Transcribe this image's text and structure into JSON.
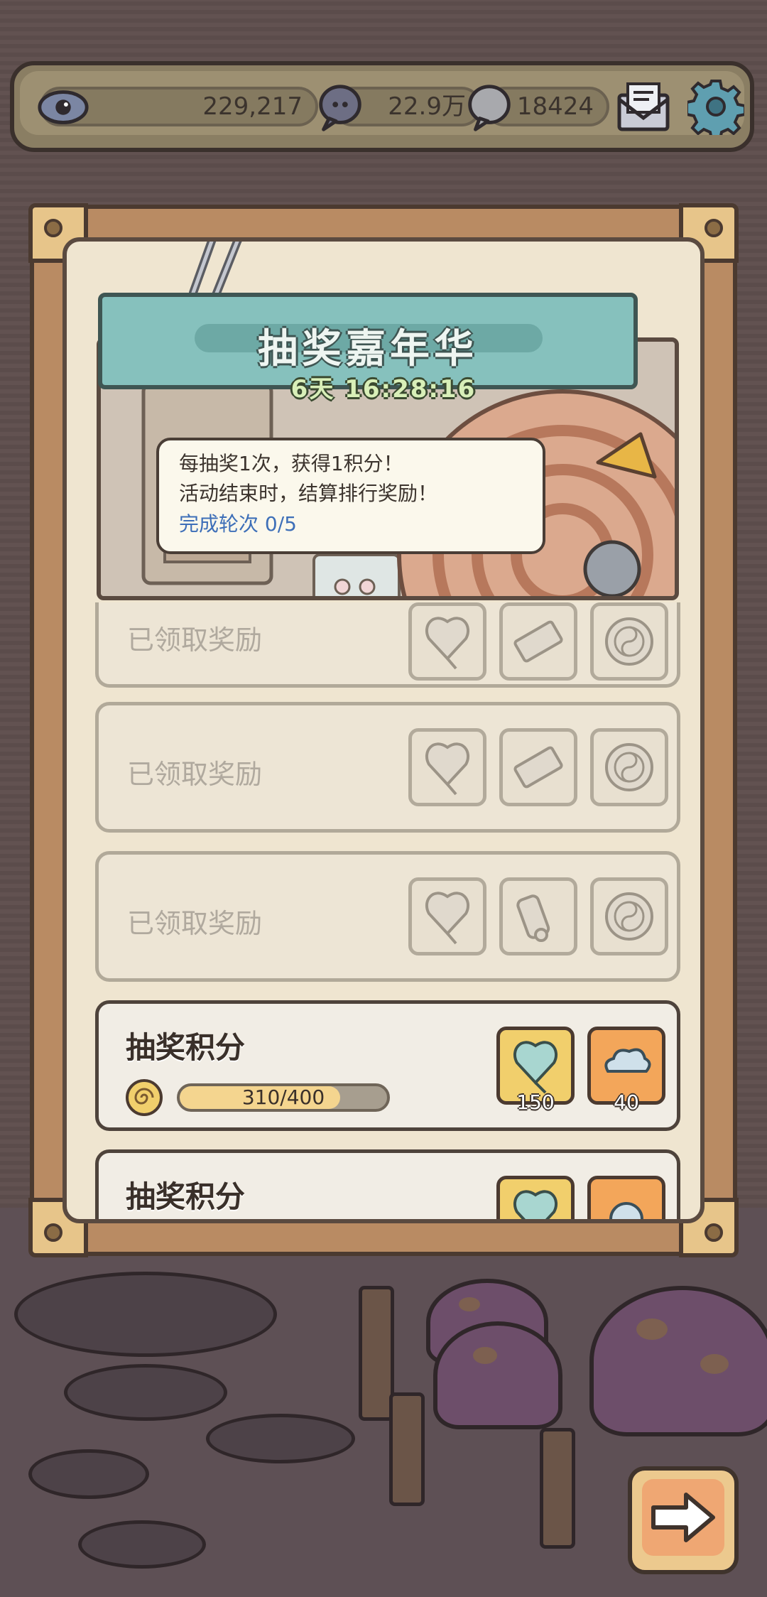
{
  "topbar": {
    "eye_value": "229,217",
    "bubble_value": "22.9万",
    "chat_value": "18424"
  },
  "panel": {
    "title": "抽奖嘉年华",
    "timer": "6天 16:28:16",
    "tip_line1": "每抽奖1次，获得1积分！",
    "tip_line2": "活动结束时，结算排行奖励！",
    "round_progress": "完成轮次  0/5"
  },
  "rows": [
    {
      "state": "claimed",
      "label": "已领取奖励",
      "rewards": [
        "balloon-icon",
        "ticket-icon",
        "yinyang-coin-icon"
      ]
    },
    {
      "state": "claimed",
      "label": "已领取奖励",
      "rewards": [
        "balloon-icon",
        "ticket-icon",
        "yinyang-coin-icon"
      ]
    },
    {
      "state": "claimed",
      "label": "已领取奖励",
      "rewards": [
        "balloon-icon",
        "cannon-icon",
        "yinyang-coin-icon"
      ]
    },
    {
      "state": "active",
      "title": "抽奖积分",
      "progress_text": "310/400",
      "progress_value": 310,
      "progress_max": 400,
      "rewards": [
        {
          "icon": "balloon-icon",
          "count": "150"
        },
        {
          "icon": "cloud-icon",
          "count": "40"
        }
      ]
    },
    {
      "state": "active",
      "title": "抽奖积分"
    }
  ],
  "colors": {
    "accent_teal": "#86c1bd",
    "panel_frame": "#b98b63",
    "gold_slot": "#f1cf6c",
    "orange_slot": "#f3a65a"
  }
}
